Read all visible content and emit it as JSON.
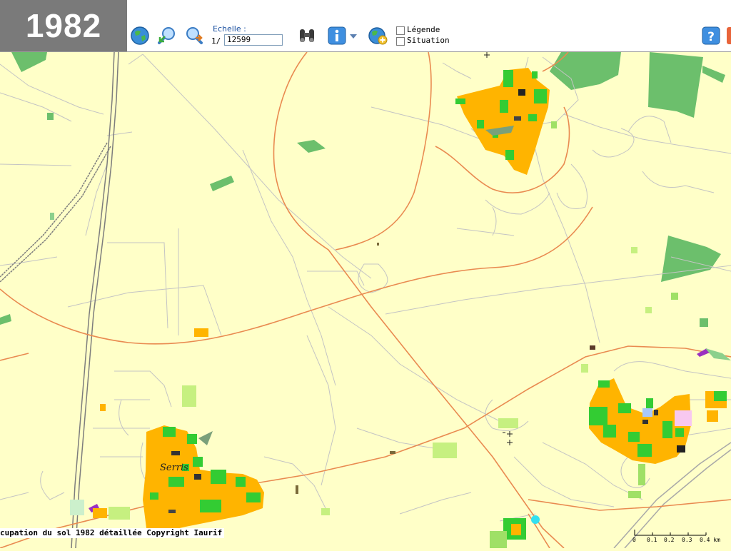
{
  "year_badge": "1982",
  "toolbar": {
    "buttons": [
      {
        "name": "globe-zoom-extent-icon"
      },
      {
        "name": "zoom-in-icon"
      },
      {
        "name": "zoom-out-icon"
      }
    ],
    "scale_label": "Echelle :",
    "scale_prefix": "1/",
    "scale_value": "12599",
    "search_icon": "binoculars-icon",
    "info_icon": "info-icon",
    "dropdown_icon": "dropdown-arrow-icon",
    "globe_add_icon": "globe-add-icon",
    "checkboxes": [
      {
        "label": "Légende",
        "checked": false
      },
      {
        "label": "Situation",
        "checked": false
      }
    ],
    "help_icon": "help-icon"
  },
  "map": {
    "place_labels": [
      "Serris"
    ],
    "copyright": "cupation du sol 1982 détaillée Copyright Iaurif",
    "scalebar_ticks": [
      "0",
      "0.1",
      "0.2",
      "0.3",
      "0.4 km"
    ]
  },
  "colors": {
    "background": "#ffffc8",
    "habitat": "#ffb400",
    "green_space": "#33cc33",
    "forest": "#66bb66",
    "roads_major": "#e98a50",
    "roads_minor": "#bcbcbc",
    "badge": "#7a7a7a"
  }
}
